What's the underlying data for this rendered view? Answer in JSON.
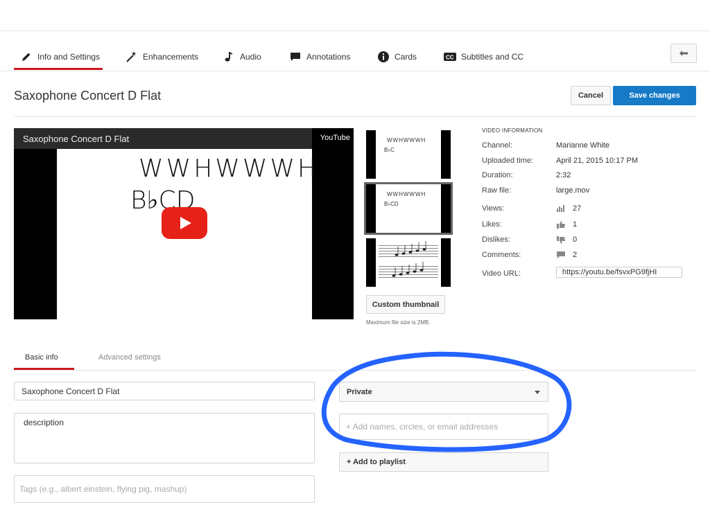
{
  "tabs": [
    {
      "label": "Info and Settings",
      "icon": "pencil-icon"
    },
    {
      "label": "Enhancements",
      "icon": "magic-wand-icon"
    },
    {
      "label": "Audio",
      "icon": "music-note-icon"
    },
    {
      "label": "Annotations",
      "icon": "speech-bubble-icon"
    },
    {
      "label": "Cards",
      "icon": "info-icon"
    },
    {
      "label": "Subtitles and CC",
      "icon": "cc-icon"
    }
  ],
  "header": {
    "title": "Saxophone Concert D Flat",
    "cancel_label": "Cancel",
    "save_label": "Save changes"
  },
  "player": {
    "title": "Saxophone Concert D Flat",
    "brand": "YouTube",
    "frame_line1": "WWHWWWH",
    "frame_line2": "B♭CD"
  },
  "thumbnails": {
    "t1_line1": "WWHWWWH",
    "t1_line2": "B♭C",
    "t2_line1": "WWHWWWH",
    "t2_line2": "B♭CD",
    "custom_label": "Custom thumbnail",
    "max_size_note": "Maximum file size is 2MB."
  },
  "video_info": {
    "heading": "VIDEO INFORMATION",
    "channel_label": "Channel:",
    "channel": "Marianne White",
    "uploaded_label": "Uploaded time:",
    "uploaded": "April 21, 2015 10:17 PM",
    "duration_label": "Duration:",
    "duration": "2:32",
    "raw_file_label": "Raw file:",
    "raw_file": "large.mov",
    "views_label": "Views:",
    "views": "27",
    "likes_label": "Likes:",
    "likes": "1",
    "dislikes_label": "Dislikes:",
    "dislikes": "0",
    "comments_label": "Comments:",
    "comments": "2",
    "url_label": "Video URL:",
    "url": "https://youtu.be/fsvxPG9fjHI"
  },
  "subtabs": {
    "basic": "Basic info",
    "advanced": "Advanced settings"
  },
  "form": {
    "title_value": "Saxophone Concert D Flat",
    "description_value": "description",
    "tags_placeholder": "Tags (e.g., albert einstein, flying pig, mashup)",
    "privacy": "Private",
    "share_placeholder": "+ Add names, circles, or email addresses",
    "playlist_label": "+ Add to playlist"
  },
  "colors": {
    "accent_red": "#cc181e",
    "save_blue": "#167ac6",
    "annotation_blue": "#2563ff"
  }
}
